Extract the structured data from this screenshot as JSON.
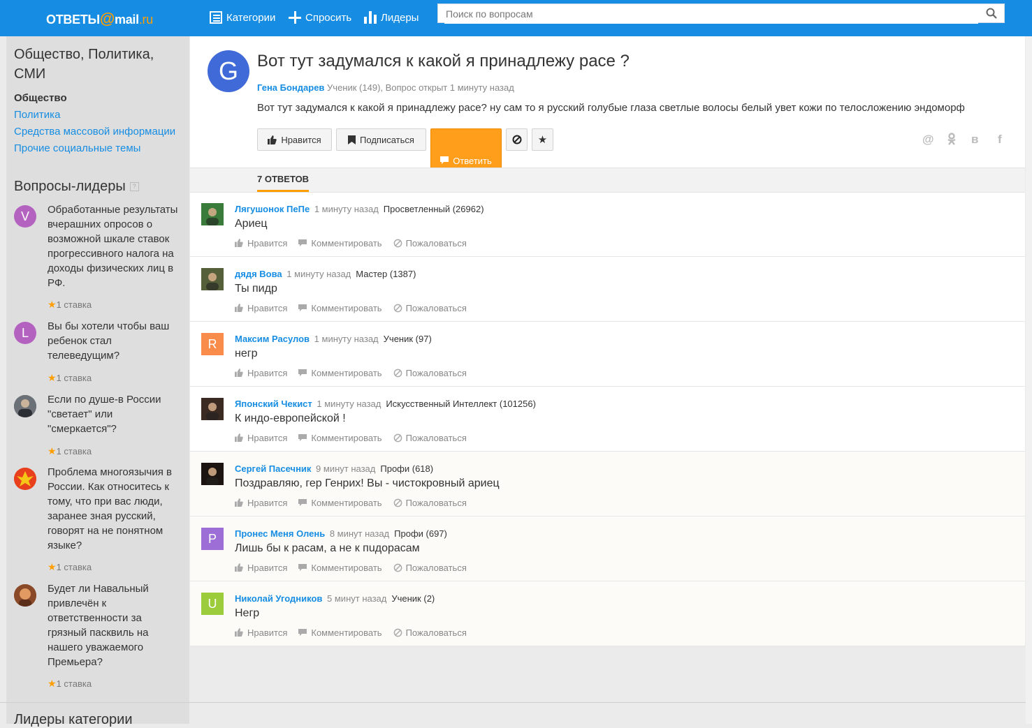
{
  "header": {
    "logo_text": "ОТВЕТЫ",
    "logo_at": "@",
    "logo_mail": "mail",
    "logo_ru": ".ru",
    "nav": {
      "categories": "Категории",
      "ask": "Спросить",
      "leaders": "Лидеры"
    },
    "search_placeholder": "Поиск по вопросам"
  },
  "sidebar": {
    "category_title": "Общество, Политика, СМИ",
    "subcategories": [
      {
        "label": "Общество",
        "active": true
      },
      {
        "label": "Политика",
        "active": false
      },
      {
        "label": "Средства массовой информации",
        "active": false
      },
      {
        "label": "Прочие социальные темы",
        "active": false
      }
    ],
    "leaders_heading": "Вопросы-лидеры",
    "help_glyph": "?",
    "leader_questions": [
      {
        "avatar_letter": "V",
        "avatar_color": "#b462c0",
        "text": "Обработанные результаты вчерашних опросов о возможной шкале ставок прогрессивного налога на доходы физических лиц в РФ.",
        "bets": "1 ставка"
      },
      {
        "avatar_letter": "L",
        "avatar_color": "#b462c0",
        "text": "Вы бы хотели чтобы ваш ребенок стал телеведущим?",
        "bets": "1 ставка"
      },
      {
        "avatar_letter": "",
        "avatar_color": "#4a4f55",
        "text": "Если по душе-в России \"светает\" или \"смеркается\"?",
        "bets": "1 ставка"
      },
      {
        "avatar_letter": "",
        "avatar_color": "#e8401c",
        "text": "Проблема многоязычия в России. Как относитесь к тому, что при вас люди, заранее зная русский, говорят на не понятном языке?",
        "bets": "1 ставка"
      },
      {
        "avatar_letter": "",
        "avatar_color": "#b0643a",
        "text": "Будет ли Навальный привлечён к ответственности за грязный пасквиль на нашего уважаемого Премьера?",
        "bets": "1 ставка"
      }
    ],
    "bottom_heading": "Лидеры категории"
  },
  "question": {
    "avatar_letter": "G",
    "title": "Вот тут задумался к какой я принадлежу расе ?",
    "author": "Гена Бондарев",
    "meta": "Ученик (149), Вопрос открыт 1 минуту назад",
    "body": "Вот тут задумался к какой я принадлежу расе? ну сам то я русский голубые глаза светлые волосы белый увет кожи по телосложению эндоморф",
    "buttons": {
      "like": "Нравится",
      "subscribe": "Подписаться",
      "answer": "Ответить"
    },
    "share": {
      "mail": "@",
      "ok": "ok",
      "vk": "в",
      "fb": "f"
    }
  },
  "answers_tab": "7 ОТВЕТОВ",
  "answer_actions": {
    "like": "Нравится",
    "comment": "Комментировать",
    "report": "Пожаловаться"
  },
  "answers": [
    {
      "name": "Лягушонок ПеПе",
      "time": "1 минуту назад",
      "rank": "Просветленный (26962)",
      "text": "Ариец",
      "avatar_letter": "",
      "avatar_color": "#3a7a3a"
    },
    {
      "name": "дядя Вова",
      "time": "1 минуту назад",
      "rank": "Мастер (1387)",
      "text": "Ты пидр",
      "avatar_letter": "",
      "avatar_color": "#55603a"
    },
    {
      "name": "Максим Расулов",
      "time": "1 минуту назад",
      "rank": "Ученик (97)",
      "text": "негр",
      "avatar_letter": "R",
      "avatar_color": "#f98c4b"
    },
    {
      "name": "Японский Чекист",
      "time": "1 минуту назад",
      "rank": "Искусственный Интеллект (101256)",
      "text": "К индо-европейской !",
      "avatar_letter": "",
      "avatar_color": "#3b2a22"
    },
    {
      "name": "Сергей Пасечник",
      "time": "9 минут назад",
      "rank": "Профи (618)",
      "text": "Поздравляю, гер Генрих! Вы - чистокровный ариец",
      "avatar_letter": "",
      "avatar_color": "#1c1410"
    },
    {
      "name": "Пронес Меня Олень",
      "time": "8 минут назад",
      "rank": "Профи (697)",
      "text": "Лишь бы к расам, а не к пuдорасам",
      "avatar_letter": "P",
      "avatar_color": "#9c6ed6"
    },
    {
      "name": "Николай Угодников",
      "time": "5 минут назад",
      "rank": "Ученик (2)",
      "text": "Негр",
      "avatar_letter": "U",
      "avatar_color": "#9ccc3c"
    }
  ]
}
